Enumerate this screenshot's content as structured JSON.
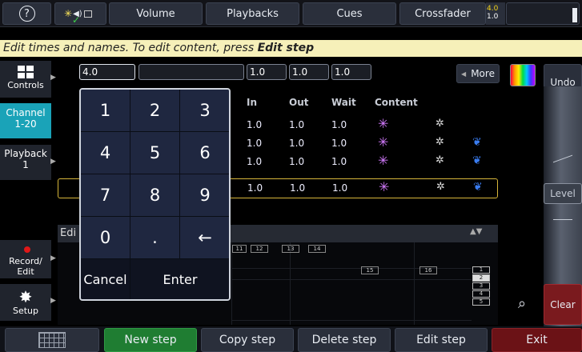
{
  "topbar": {
    "help_icon": "?",
    "volume": "Volume",
    "playbacks": "Playbacks",
    "cues": "Cues",
    "crossfader": "Crossfader",
    "cf_value_1": "4.0",
    "cf_value_2": "1.0"
  },
  "instruction": {
    "text": "Edit times and names. To edit content, press ",
    "bold": "Edit step"
  },
  "sidebar": {
    "controls": "Controls",
    "channel_label": "Channel",
    "channel_range": "1-20",
    "playback_label": "Playback",
    "playback_num": "1",
    "record_label": "Record/",
    "record_label2": "Edit",
    "setup": "Setup"
  },
  "fields": {
    "step": "4.0",
    "name": "",
    "in": "1.0",
    "out": "1.0",
    "wait": "1.0"
  },
  "more": "More",
  "undo": "Undo",
  "level": "Level",
  "clear": "Clear",
  "table": {
    "headers": {
      "in": "In",
      "out": "Out",
      "wait": "Wait",
      "content": "Content"
    },
    "rows": [
      {
        "in": "1.0",
        "out": "1.0",
        "wait": "1.0"
      },
      {
        "in": "1.0",
        "out": "1.0",
        "wait": "1.0"
      },
      {
        "in": "1.0",
        "out": "1.0",
        "wait": "1.0"
      },
      {
        "in": "1.0",
        "out": "1.0",
        "wait": "1.0"
      }
    ]
  },
  "lower": {
    "edit_partial": "Edi",
    "slots": [
      "11",
      "12",
      "13",
      "14"
    ],
    "slot_15": "15",
    "slot_16": "16",
    "playback_slots": [
      "1",
      "2",
      "3",
      "4",
      "5"
    ]
  },
  "keypad": {
    "keys": [
      "1",
      "2",
      "3",
      "4",
      "5",
      "6",
      "7",
      "8",
      "9",
      "0",
      ".",
      "←"
    ],
    "cancel": "Cancel",
    "enter": "Enter"
  },
  "bottom": {
    "new_step": "New step",
    "copy_step": "Copy step",
    "delete_step": "Delete step",
    "edit_step": "Edit step",
    "exit": "Exit"
  },
  "colors": {
    "new_step_bg": "#1f7d32",
    "exit_bg": "#6b1216",
    "clear_bg": "#7a1a1e",
    "channel_bg": "#1aa3b8",
    "instruction_bg": "#f6f0b9"
  }
}
